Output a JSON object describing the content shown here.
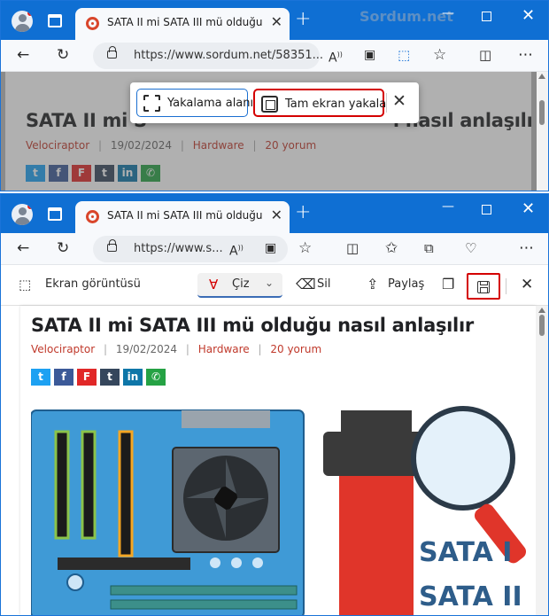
{
  "browser": {
    "brand": "Sordum.net",
    "tab_title": "SATA II mi SATA III mü olduğu nasıl",
    "url_top": "https://www.sordum.net/58351...",
    "url_bottom": "https://www.s..."
  },
  "capture_bar": {
    "area_label": "Yakalama alanı",
    "full_label": "Tam ekran yakala"
  },
  "screenshot_toolbar": {
    "title": "Ekran görüntüsü",
    "draw_label": "Çiz",
    "erase_label": "Sil",
    "share_label": "Paylaş"
  },
  "article": {
    "title": "SATA II mi SATA III mü olduğu nasıl anlaşılır",
    "title_obscured_top": "SATA II mi S",
    "title_obscured_tail": "ı nasıl anlaşılır",
    "author": "Velociraptor",
    "date": "19/02/2024",
    "category": "Hardware",
    "comments": "20 yorum",
    "separator": "|",
    "share_buttons": [
      {
        "icon": "twitter-icon",
        "glyph": "t",
        "color": "#1da1f2"
      },
      {
        "icon": "facebook-icon",
        "glyph": "f",
        "color": "#3b5998"
      },
      {
        "icon": "flipboard-icon",
        "glyph": "F",
        "color": "#e12828"
      },
      {
        "icon": "tumblr-icon",
        "glyph": "t",
        "color": "#35465c"
      },
      {
        "icon": "linkedin-icon",
        "glyph": "in",
        "color": "#0e76a8"
      },
      {
        "icon": "whatsapp-icon",
        "glyph": "✆",
        "color": "#25a244"
      }
    ],
    "image_text_1": "SATA I",
    "image_text_2": "SATA II"
  },
  "colors": {
    "titlebar": "#0f6fd3",
    "accent_red": "#c0392b",
    "highlight": "#d40000"
  }
}
